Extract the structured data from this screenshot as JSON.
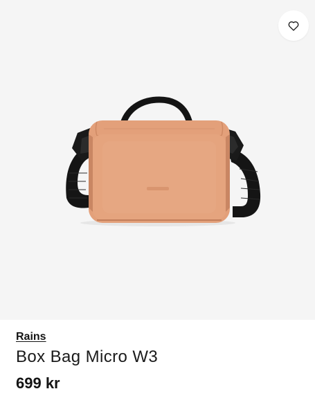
{
  "favorite": {
    "icon": "heart-outline-icon",
    "label": "Add to favorites"
  },
  "product": {
    "image_alt": "Box Bag Micro W3",
    "colors": {
      "bag": "#e3a07a",
      "strap": "#1c1c1c",
      "background": "#f5f5f5"
    },
    "brand": "Rains",
    "name": "Box Bag Micro W3",
    "price": "699 kr"
  }
}
